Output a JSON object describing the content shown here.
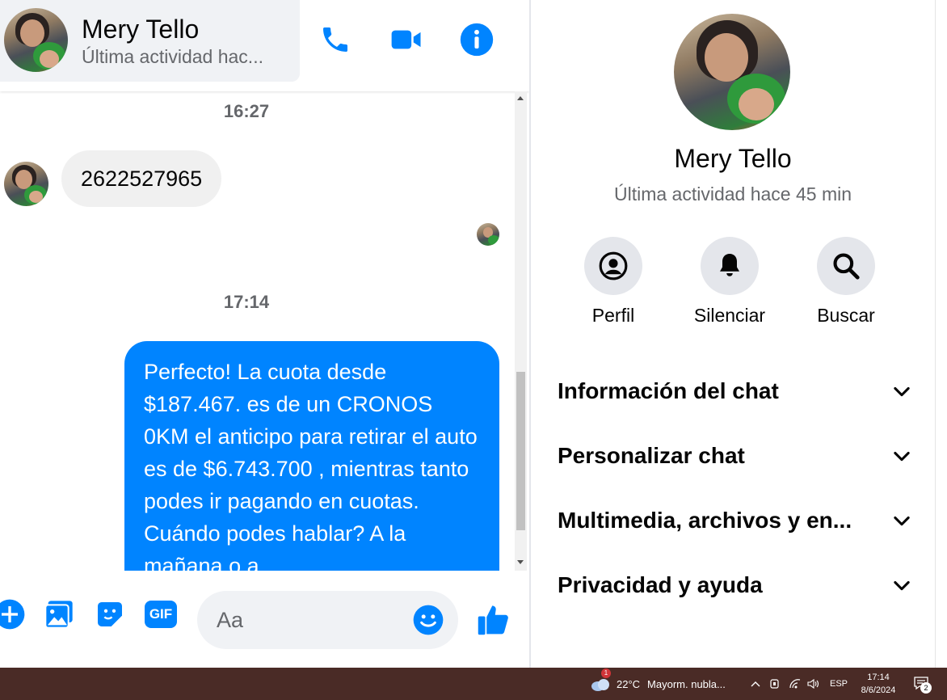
{
  "header": {
    "contact_name": "Mery Tello",
    "status": "Última actividad hac...",
    "icons": [
      "phone-icon",
      "video-camera-icon",
      "info-icon"
    ]
  },
  "messages": {
    "time_1": "16:27",
    "incoming_text": "2622527965",
    "time_2": "17:14",
    "outgoing_text": "Perfecto! La cuota desde $187.467. es de un CRONOS 0KM el anticipo para retirar el auto es de $6.743.700 , mientras tanto podes ir pagando en cuotas. Cuándo podes hablar? A la mañana o a"
  },
  "composer": {
    "placeholder": "Aa",
    "icons": [
      "plus-icon",
      "image-icon",
      "sticker-icon",
      "gif-icon",
      "emoji-icon",
      "thumbs-up-icon"
    ],
    "gif_label": "GIF"
  },
  "info": {
    "name": "Mery Tello",
    "status": "Última actividad hace 45 min",
    "actions": [
      {
        "label": "Perfil",
        "icon": "profile-icon"
      },
      {
        "label": "Silenciar",
        "icon": "bell-icon"
      },
      {
        "label": "Buscar",
        "icon": "search-icon"
      }
    ],
    "sections": [
      {
        "title": "Información del chat"
      },
      {
        "title": "Personalizar chat"
      },
      {
        "title": "Multimedia, archivos y en..."
      },
      {
        "title": "Privacidad y ayuda"
      }
    ]
  },
  "taskbar": {
    "weather_badge": "1",
    "temperature": "22°C",
    "weather_text": "Mayorm. nubla...",
    "language": "ESP",
    "time": "17:14",
    "date": "8/6/2024",
    "notification_count": "2"
  },
  "colors": {
    "accent": "#0084ff",
    "incoming_bubble": "#f0f0f0",
    "taskbar": "#4a2b26"
  }
}
